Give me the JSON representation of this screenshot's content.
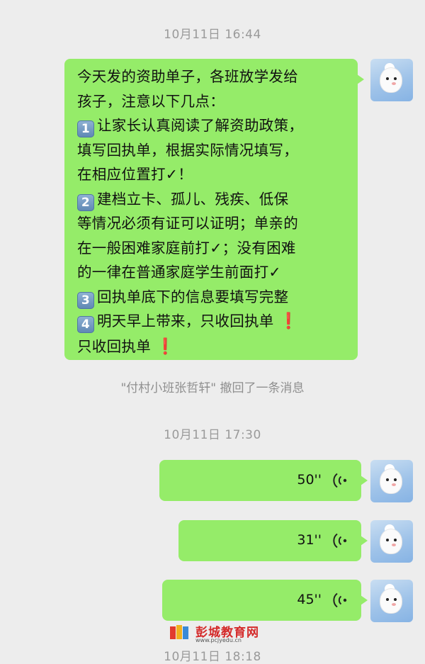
{
  "messages": {
    "time1": "10月11日 16:44",
    "text_lines": [
      "今天发的资助单子，各班放学发给",
      "孩子，注意以下几点：",
      "让家长认真阅读了解资助政策，",
      "填写回执单，根据实际情况填写，",
      "在相应位置打✓！",
      "建档立卡、孤儿、残疾、低保",
      "等情况必须有证可以证明；单亲的",
      "在一般困难家庭前打✓；没有困难",
      "的一律在普通家庭学生前面打✓",
      "回执单底下的信息要填写完整",
      "明天早上带来，只收回执单",
      "只收回执单"
    ],
    "keycaps": [
      "1",
      "2",
      "3",
      "4"
    ],
    "exclaim": "❗",
    "recall_notice": "\"付村小班张哲轩\" 撤回了一条消息",
    "time2": "10月11日 17:30",
    "voice": [
      {
        "duration": "50''"
      },
      {
        "duration": "31''"
      },
      {
        "duration": "45''"
      }
    ],
    "time3": "10月11日 18:18"
  },
  "watermark": {
    "name": "彭城教育网",
    "url": "www.pcjyedu.cn"
  },
  "colors": {
    "bubble": "#95ec69",
    "background": "#ededed",
    "timestamp": "#9a9a9a"
  }
}
